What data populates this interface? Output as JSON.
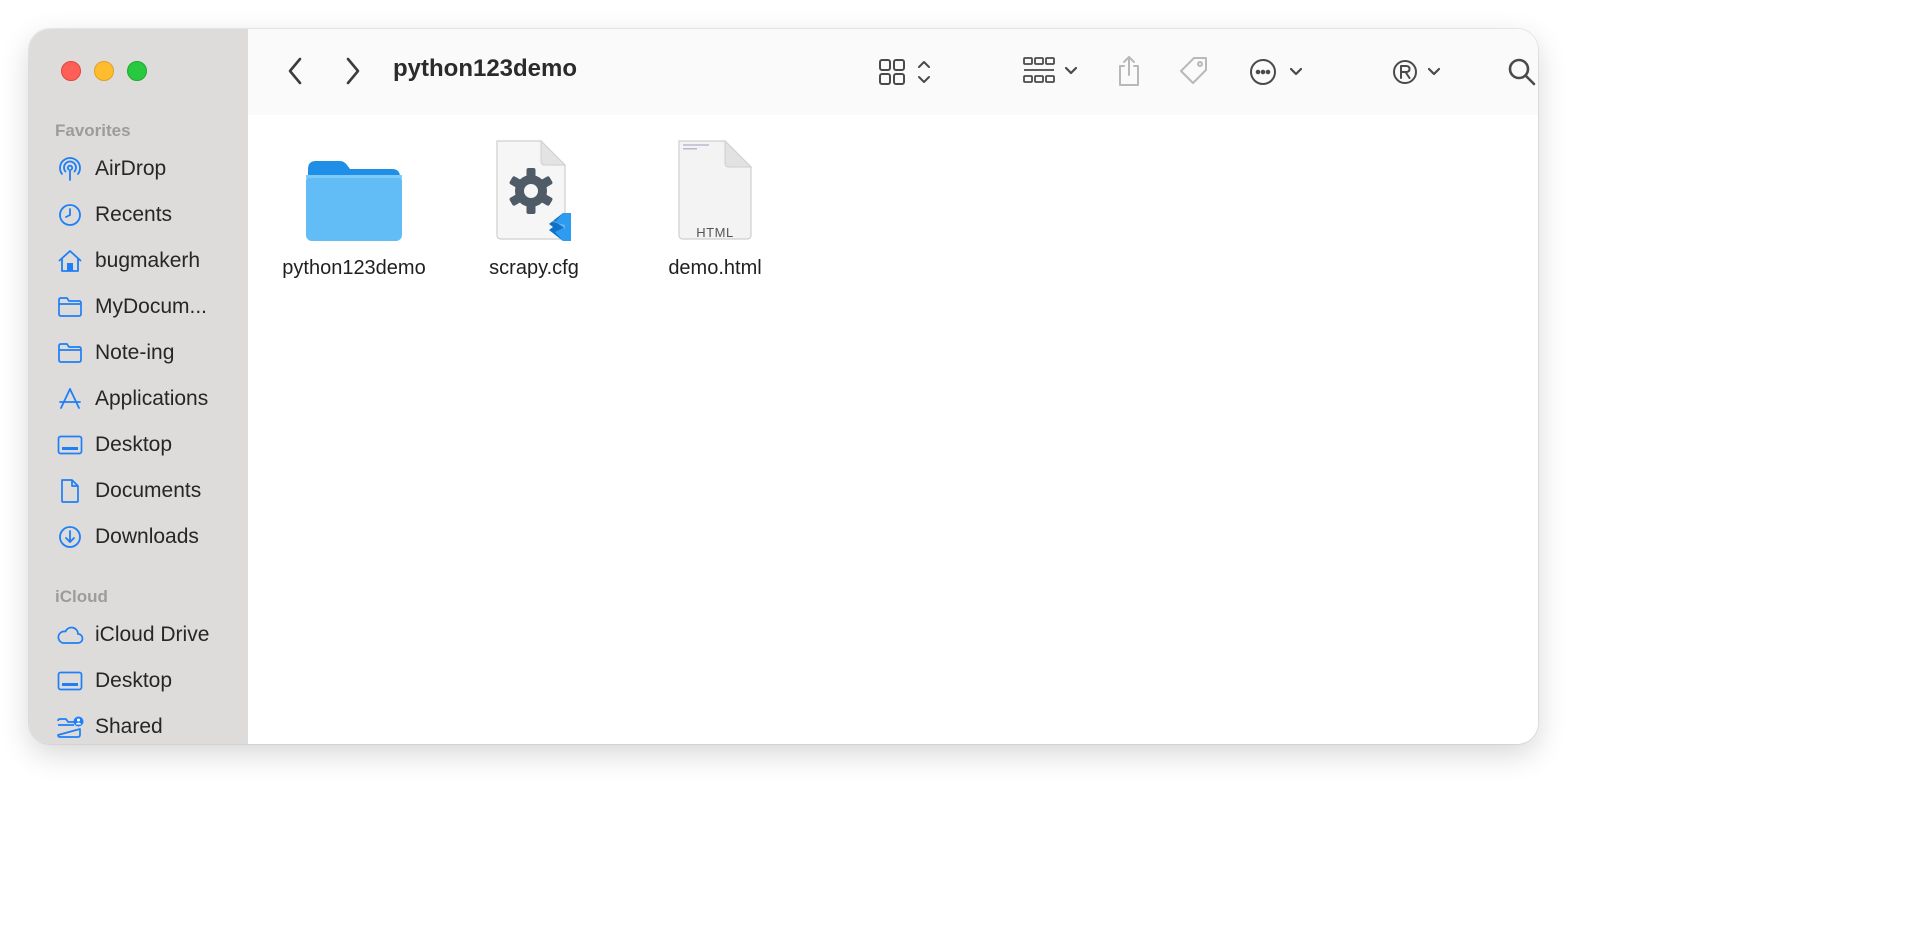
{
  "window": {
    "title": "python123demo"
  },
  "sidebar": {
    "favorites_title": "Favorites",
    "favorites": [
      {
        "label": "AirDrop",
        "icon": "airdrop-icon"
      },
      {
        "label": "Recents",
        "icon": "clock-icon"
      },
      {
        "label": "bugmakerh",
        "icon": "home-icon"
      },
      {
        "label": "MyDocum...",
        "icon": "folder-icon"
      },
      {
        "label": "Note-ing",
        "icon": "folder-icon"
      },
      {
        "label": "Applications",
        "icon": "applications-icon"
      },
      {
        "label": "Desktop",
        "icon": "desktop-icon"
      },
      {
        "label": "Documents",
        "icon": "document-icon"
      },
      {
        "label": "Downloads",
        "icon": "download-icon"
      }
    ],
    "icloud_title": "iCloud",
    "icloud": [
      {
        "label": "iCloud Drive",
        "icon": "cloud-icon"
      },
      {
        "label": "Desktop",
        "icon": "desktop-icon"
      },
      {
        "label": "Shared",
        "icon": "shared-folder-icon"
      }
    ]
  },
  "files": [
    {
      "name": "python123demo",
      "kind": "folder"
    },
    {
      "name": "scrapy.cfg",
      "kind": "config-file"
    },
    {
      "name": "demo.html",
      "kind": "html-file",
      "badge": "HTML"
    }
  ],
  "colors": {
    "accent": "#1e7ff6",
    "sidebar": "#dedcdb",
    "folder": "#62bdf7"
  }
}
